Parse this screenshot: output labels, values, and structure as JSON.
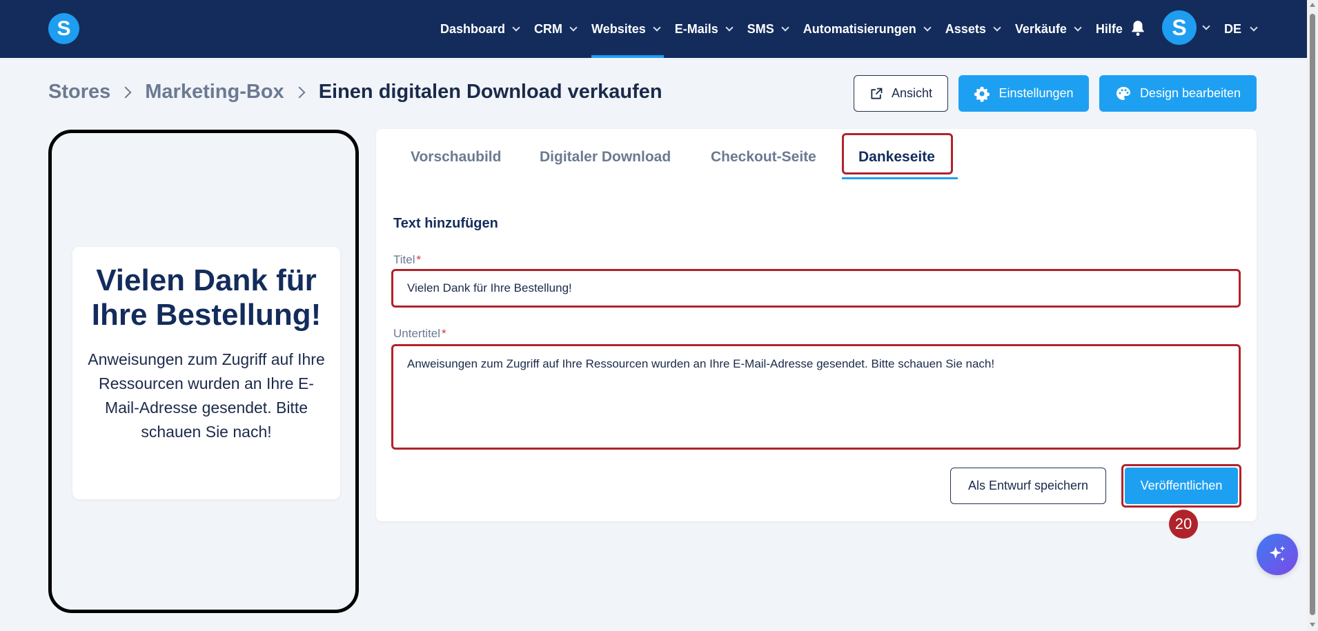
{
  "brand": {
    "logo_letter": "S"
  },
  "nav": {
    "items": [
      {
        "label": "Dashboard",
        "chevron": true,
        "active": false
      },
      {
        "label": "CRM",
        "chevron": true,
        "active": false
      },
      {
        "label": "Websites",
        "chevron": true,
        "active": true
      },
      {
        "label": "E-Mails",
        "chevron": true,
        "active": false
      },
      {
        "label": "SMS",
        "chevron": true,
        "active": false
      },
      {
        "label": "Automatisierungen",
        "chevron": true,
        "active": false
      },
      {
        "label": "Assets",
        "chevron": true,
        "active": false
      },
      {
        "label": "Verkäufe",
        "chevron": true,
        "active": false
      },
      {
        "label": "Hilfe",
        "chevron": false,
        "active": false
      }
    ],
    "avatar_letter": "S",
    "language": "DE"
  },
  "breadcrumb": {
    "items": [
      "Stores",
      "Marketing-Box",
      "Einen digitalen Download verkaufen"
    ]
  },
  "header_buttons": {
    "view": "Ansicht",
    "settings": "Einstellungen",
    "design": "Design bearbeiten"
  },
  "preview": {
    "title": "Vielen Dank für Ihre Bestellung!",
    "subtitle": "Anweisungen zum Zugriff auf Ihre Ressourcen wurden an Ihre E-Mail-Adresse gesendet. Bitte schauen Sie nach!"
  },
  "tabs": [
    {
      "label": "Vorschaubild",
      "active": false
    },
    {
      "label": "Digitaler Download",
      "active": false
    },
    {
      "label": "Checkout-Seite",
      "active": false
    },
    {
      "label": "Dankeseite",
      "active": true
    }
  ],
  "form": {
    "section_title": "Text hinzufügen",
    "title_label": "Titel",
    "title_value": "Vielen Dank für Ihre Bestellung!",
    "subtitle_label": "Untertitel",
    "subtitle_value": "Anweisungen zum Zugriff auf Ihre Ressourcen wurden an Ihre E-Mail-Adresse gesendet. Bitte schauen Sie nach!",
    "required_mark": "*",
    "save_draft": "Als Entwurf speichern",
    "publish": "Veröffentlichen"
  },
  "step_badge": "20",
  "colors": {
    "nav_bg": "#132c5c",
    "accent": "#1ea0f2",
    "highlight": "#b0232b"
  },
  "icons": {
    "external_link": "external-link-icon",
    "gear": "gear-icon",
    "palette": "palette-icon",
    "bell": "bell-icon",
    "sparkle": "sparkle-icon"
  }
}
